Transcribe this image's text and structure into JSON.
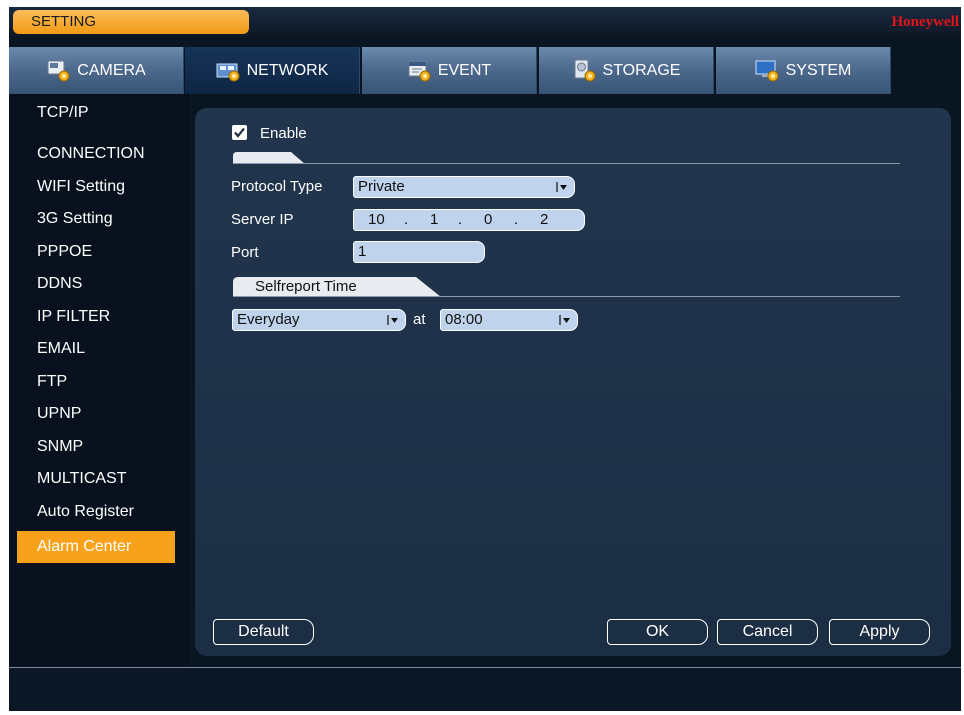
{
  "window": {
    "title": "SETTING",
    "brand": "Honeywell"
  },
  "tabs": [
    {
      "label": "CAMERA",
      "icon": "camera-settings-icon",
      "active": false
    },
    {
      "label": "NETWORK",
      "icon": "network-settings-icon",
      "active": true
    },
    {
      "label": "EVENT",
      "icon": "event-settings-icon",
      "active": false
    },
    {
      "label": "STORAGE",
      "icon": "storage-settings-icon",
      "active": false
    },
    {
      "label": "SYSTEM",
      "icon": "system-settings-icon",
      "active": false
    }
  ],
  "sidebar": {
    "items": [
      {
        "label": "TCP/IP"
      },
      {
        "label": "CONNECTION"
      },
      {
        "label": "WIFI Setting"
      },
      {
        "label": "3G Setting"
      },
      {
        "label": "PPPOE"
      },
      {
        "label": "DDNS"
      },
      {
        "label": "IP FILTER"
      },
      {
        "label": "EMAIL"
      },
      {
        "label": "FTP"
      },
      {
        "label": "UPNP"
      },
      {
        "label": "SNMP"
      },
      {
        "label": "MULTICAST"
      },
      {
        "label": "Auto Register"
      },
      {
        "label": "Alarm Center",
        "active": true
      }
    ]
  },
  "form": {
    "enable_label": "Enable",
    "enable_checked": true,
    "protocol_label": "Protocol Type",
    "protocol_value": "Private",
    "server_ip_label": "Server IP",
    "server_ip": [
      "10",
      "1",
      "0",
      "2"
    ],
    "port_label": "Port",
    "port_value": "1",
    "selfreport_section": "Selfreport Time",
    "schedule_value": "Everyday",
    "at_label": "at",
    "time_value": "08:00"
  },
  "buttons": {
    "default_label": "Default",
    "ok_label": "OK",
    "cancel_label": "Cancel",
    "apply_label": "Apply"
  },
  "colors": {
    "accent": "#f7a21a",
    "brand": "#e4141b",
    "panel": "#1f3249",
    "background": "#0a1522"
  }
}
